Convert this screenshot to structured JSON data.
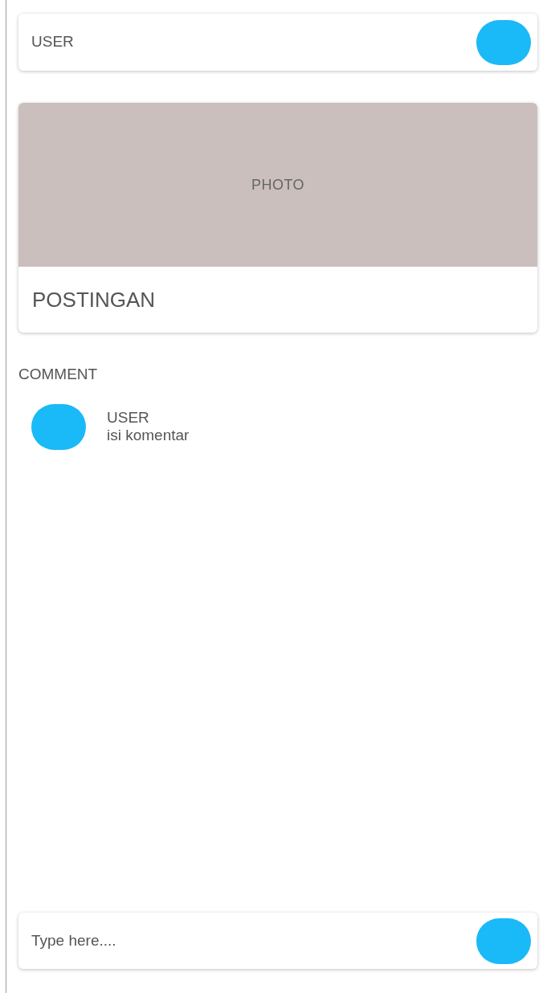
{
  "header": {
    "user": "USER"
  },
  "post": {
    "photo_label": "PHOTO",
    "caption": "POSTINGAN"
  },
  "comments_heading": "COMMENT",
  "comments": [
    {
      "user": "USER",
      "text": "isi komentar"
    }
  ],
  "composer": {
    "placeholder": "Type here...."
  }
}
